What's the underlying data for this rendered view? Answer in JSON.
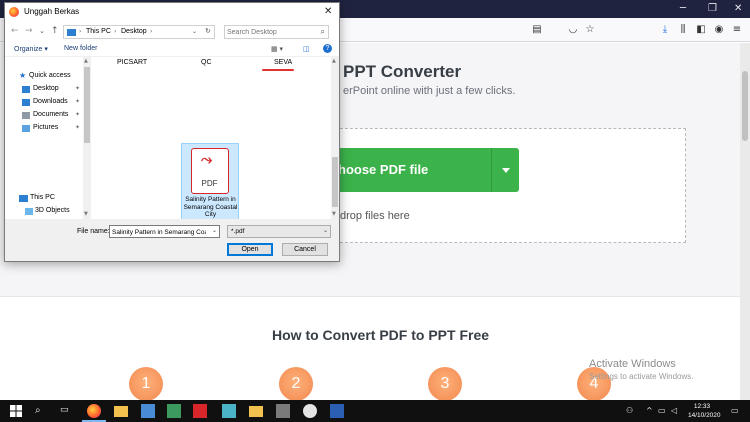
{
  "browser": {
    "icons": [
      "minimize-icon",
      "maximize-icon",
      "close-icon",
      "reader-icon",
      "pocket-icon",
      "star-icon",
      "download-icon",
      "library-icon",
      "sidebar-icon",
      "account-icon",
      "menu-icon"
    ]
  },
  "page": {
    "hero_title": "PPT Converter",
    "hero_subtitle": "erPoint online with just a few clicks.",
    "choose_button": "hoose PDF file",
    "drop_text": "drop files here",
    "how_title": "How to Convert PDF to PPT Free",
    "steps": [
      "1",
      "2",
      "3",
      "4"
    ],
    "watermark_title": "Activate Windows",
    "watermark_sub": "Settings to activate Windows."
  },
  "dialog": {
    "title": "Unggah Berkas",
    "breadcrumb": [
      "This PC",
      "Desktop"
    ],
    "search_placeholder": "Search Desktop",
    "toolbar": {
      "organize": "Organize ▾",
      "new_folder": "New folder"
    },
    "help": "?",
    "nav_items": [
      {
        "label": "Quick access"
      },
      {
        "label": "Desktop"
      },
      {
        "label": "Downloads"
      },
      {
        "label": "Documents"
      },
      {
        "label": "Pictures"
      },
      {
        "label": "This PC"
      },
      {
        "label": "3D Objects"
      }
    ],
    "folders": [
      "PICSART",
      "QC",
      "SEVA"
    ],
    "selected_file": {
      "name": "Salinity Pattern in Semarang Coastal City",
      "icon_text": "PDF"
    },
    "file_name_label": "File name:",
    "file_name_value": "Salinity Pattern in Semarang Coast",
    "file_type": "*.pdf",
    "open_button": "Open",
    "cancel_button": "Cancel"
  },
  "taskbar": {
    "clock_time": "12:33",
    "clock_date": "14/10/2020"
  },
  "colors": {
    "browser_frame": "#202340",
    "green_button": "#3cb24a",
    "step_orange": "#f0894f",
    "pdf_red": "#d8262a",
    "selection": "#cce8ff"
  }
}
